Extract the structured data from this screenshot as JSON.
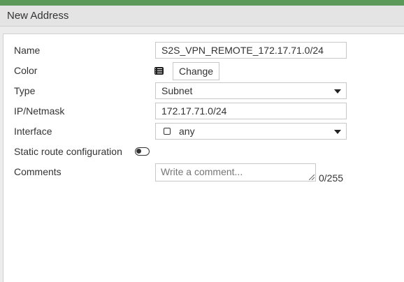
{
  "window": {
    "title": "New Address"
  },
  "form": {
    "name": {
      "label": "Name",
      "value": "S2S_VPN_REMOTE_172.17.71.0/24"
    },
    "color": {
      "label": "Color",
      "icon": "color-swatch-icon",
      "button_label": "Change"
    },
    "type": {
      "label": "Type",
      "value": "Subnet"
    },
    "ip_netmask": {
      "label": "IP/Netmask",
      "value": "172.17.71.0/24"
    },
    "interface": {
      "label": "Interface",
      "value": "any"
    },
    "static_route": {
      "label": "Static route configuration",
      "enabled": false
    },
    "comments": {
      "label": "Comments",
      "placeholder": "Write a comment...",
      "counter": "0/255"
    }
  },
  "colors": {
    "accent": "#5c9a5a",
    "header_bg": "#e4e4e4",
    "border": "#c8c8c8"
  }
}
